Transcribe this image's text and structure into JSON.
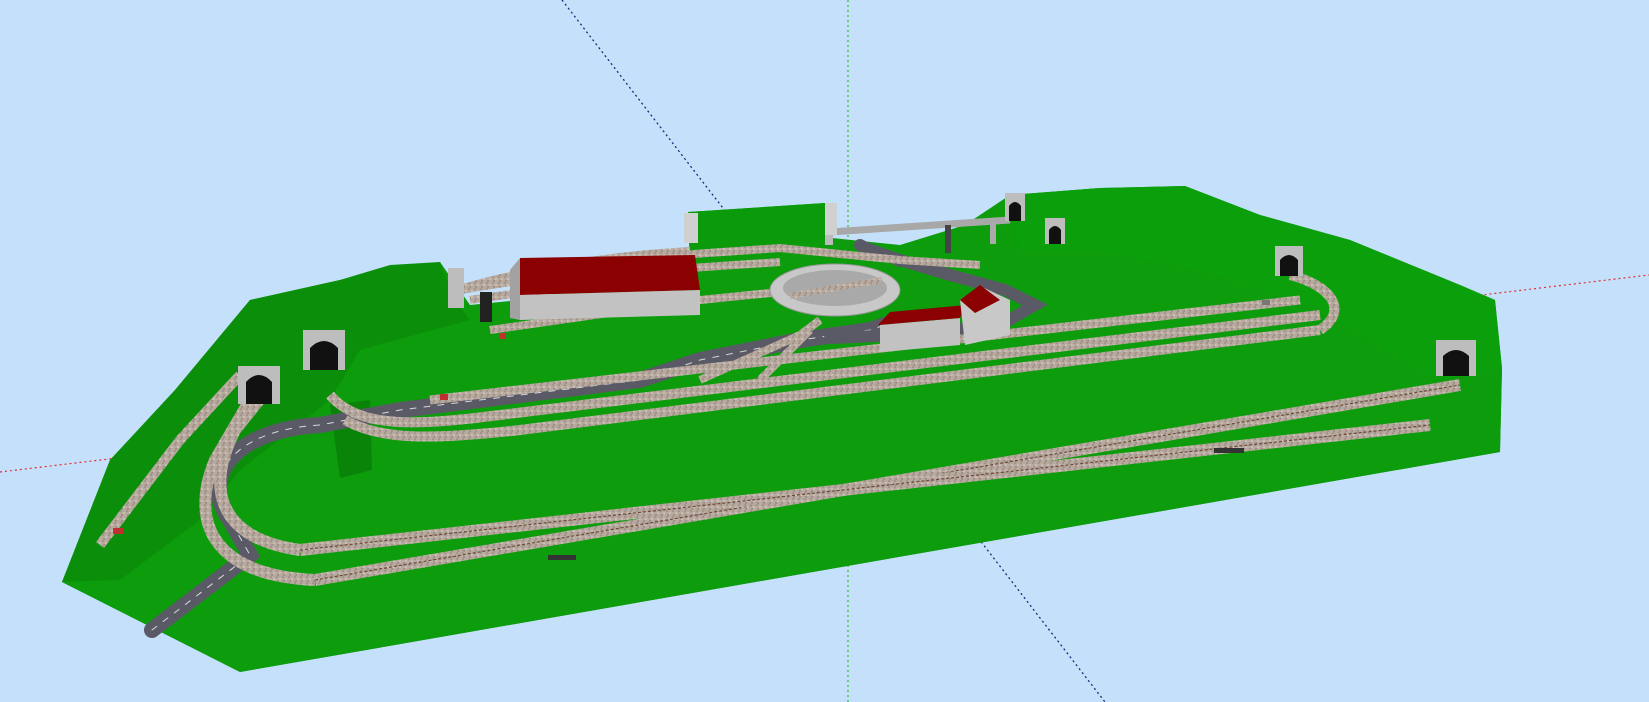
{
  "app": {
    "view": "3D perspective",
    "background_color": "#c4e0fa"
  },
  "scene": {
    "colors": {
      "terrain": "#0c9a0c",
      "terrain_dark": "#0a7d0a",
      "terrain_shadow": "#087008",
      "road": "#5a5a66",
      "road_edge": "#cfcfd4",
      "track_ballast": "#b8aaa0",
      "track_rail": "#6b4a3a",
      "roof_red": "#8b0000",
      "wall_gray": "#c0c0c0",
      "turntable": "#c8c8c8",
      "tunnel_portal": "#bdbdbd",
      "axis_x": "#e03030",
      "axis_y": "#30c030",
      "axis_z": "#2030a0"
    },
    "counts": {
      "tunnel_portals": 6,
      "buildings": 3,
      "turntables": 1
    }
  }
}
